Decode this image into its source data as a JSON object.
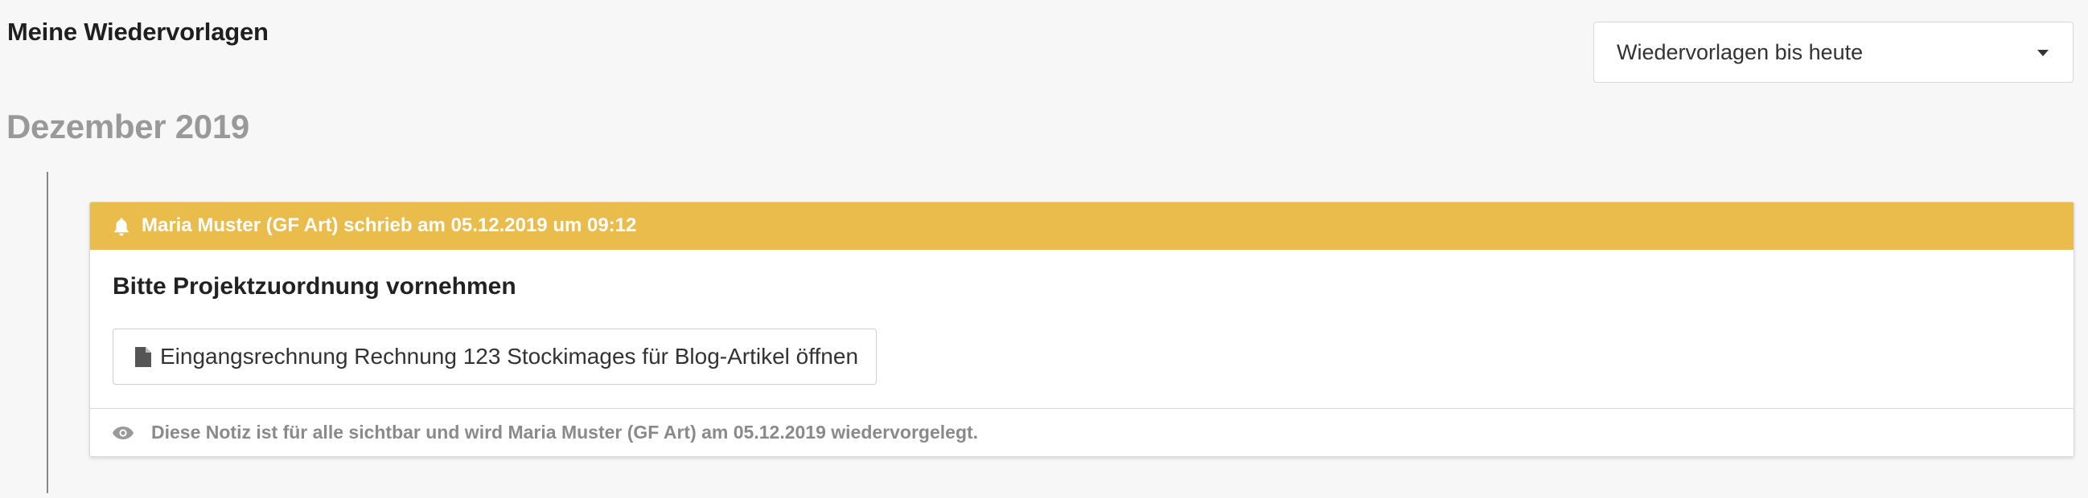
{
  "header": {
    "title": "Meine Wiedervorlagen",
    "filter": {
      "selected": "Wiedervorlagen bis heute"
    }
  },
  "timeline": {
    "month": "Dezember 2019",
    "notes": [
      {
        "author_line": "Maria Muster (GF Art) schrieb am 05.12.2019 um 09:12",
        "title": "Bitte Projektzuordnung vornehmen",
        "link_label": "Eingangsrechnung Rechnung 123 Stockimages für Blog-Artikel öffnen",
        "visibility_text": "Diese Notiz ist für alle sichtbar und wird Maria Muster (GF Art) am 05.12.2019 wiedervorgelegt.",
        "icons": {
          "header": "bell-icon",
          "link": "file-icon",
          "footer": "eye-icon"
        }
      }
    ]
  },
  "colors": {
    "background": "#f7f7f7",
    "note_header": "#e9bc4c",
    "muted_text": "#999999"
  }
}
